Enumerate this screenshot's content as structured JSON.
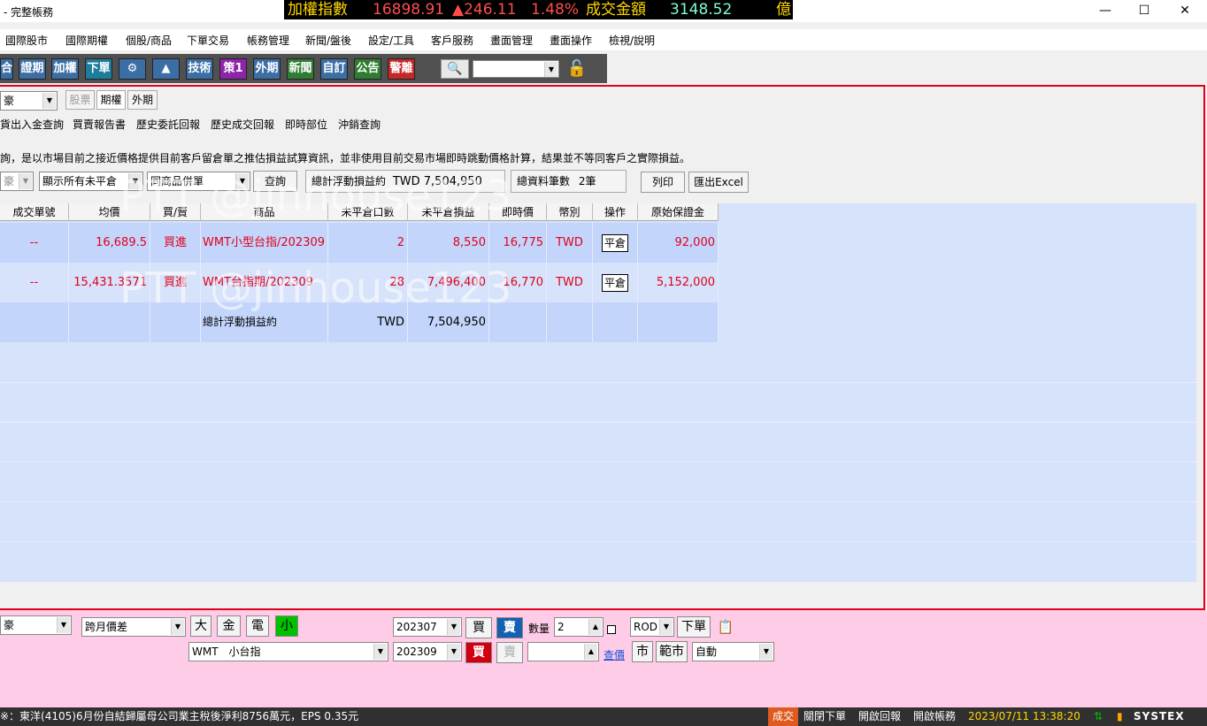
{
  "window": {
    "title": "- 完整帳務",
    "ticker": {
      "index_name": "加權指數",
      "index_value": "16898.91",
      "change": "▲246.11",
      "change_pct": "1.48%",
      "volume_label": "成交金額",
      "volume_value": "3148.52",
      "unit": "億"
    }
  },
  "menu": [
    "國際股市",
    "國際期權",
    "個股/商品",
    "下單交易",
    "帳務管理",
    "新聞/盤後",
    "設定/工具",
    "客戶服務",
    "畫面管理",
    "畫面操作",
    "檢視/說明"
  ],
  "toolbar": {
    "buttons": [
      "合",
      "證期",
      "加權",
      "下單",
      "⚙",
      "▲",
      "技術",
      "策1",
      "外期",
      "新聞",
      "自訂",
      "公告",
      "警離"
    ],
    "colors": [
      "#3a6ea5",
      "#3a6ea5",
      "#3a6ea5",
      "#1c7e9c",
      "#3a6ea5",
      "#2e7d32",
      "#3a6ea5",
      "#8e24aa",
      "#3a6ea5",
      "#2e7d32",
      "#3a6ea5",
      "#2e7d32",
      "#c62828"
    ]
  },
  "panel": {
    "account_combo": "豪",
    "market_tabs": [
      "股票",
      "期權",
      "外期"
    ],
    "sub_tabs": [
      "貨出入金查詢",
      "買賣報告書",
      "歷史委託回報",
      "歷史成交回報",
      "即時部位",
      "沖銷查詢"
    ],
    "notice": "詢，是以市場目前之接近價格提供目前客戶留倉單之推估損益試算資訊，並非使用目前交易市場即時跳動價格計算，結果並不等同客戶之實際損益。",
    "filter_combo_1": "豪",
    "filter_combo_2": "顯示所有未平倉",
    "filter_combo_3": "同商品併單",
    "query_button": "查詢",
    "total_pnl_label": "總計浮動損益約",
    "total_pnl_value": "TWD 7,504,950",
    "total_count_label": "總資料筆數",
    "total_count_value": "2筆",
    "print_button": "列印",
    "excel_button": "匯出Excel"
  },
  "grid": {
    "headers": [
      "成交單號",
      "均價",
      "買/賣",
      "商品",
      "未平倉口數",
      "未平倉損益",
      "即時價",
      "幣別",
      "操作",
      "原始保證金"
    ],
    "rows": [
      {
        "order_no": "--",
        "avg_price": "16,689.5",
        "side": "買進",
        "product": "WMT小型台指/202309",
        "qty": "2",
        "pnl": "8,550",
        "last": "16,775",
        "currency": "TWD",
        "action": "平倉",
        "margin": "92,000"
      },
      {
        "order_no": "--",
        "avg_price": "15,431.3571",
        "side": "買進",
        "product": "WMT台指期/202309",
        "qty": "28",
        "pnl": "7,496,400",
        "last": "16,770",
        "currency": "TWD",
        "action": "平倉",
        "margin": "5,152,000"
      }
    ],
    "total_row": {
      "label": "總計浮動損益約",
      "currency": "TWD",
      "value": "7,504,950"
    }
  },
  "order": {
    "account": "豪",
    "strategy": "跨月價差",
    "size_buttons": [
      "大",
      "金",
      "電",
      "小"
    ],
    "product": "WMT　小台指",
    "month_1": "202307",
    "month_2": "202309",
    "buy_label": "買",
    "sell_label": "賣",
    "qty_label": "數量",
    "qty_value": "2",
    "order_type": "ROD",
    "place_order": "下單",
    "market": "市",
    "range_market": "範市",
    "auto": "自動",
    "price_query": "查價"
  },
  "status": {
    "news": "※：東洋(4105)6月份自結歸屬母公司業主稅後淨利8756萬元，EPS 0.35元",
    "trade": "成交",
    "close_order": "關閉下單",
    "open_report": "開啟回報",
    "open_account": "開啟帳務",
    "datetime": "2023/07/11 13:38:20",
    "brand": "SYSTEX"
  },
  "watermark": "PTT @jinhouse123"
}
